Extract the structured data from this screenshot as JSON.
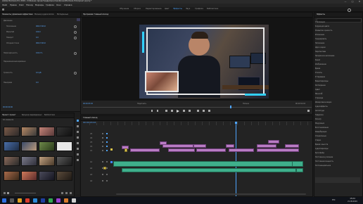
{
  "window": {
    "title": "Adobe Premiere Pro 2019 - D:\\Бизнес-проект\\видео\\монтаж\\Уроки\\Premiere Pro\\проект.prproj *",
    "controls": [
      "—",
      "□",
      "✕"
    ]
  },
  "menu": [
    "Файл",
    "Правка",
    "Клип",
    "Эпизод",
    "Маркеры",
    "Графика",
    "Окно",
    "Справка"
  ],
  "workspaces": [
    "Обучение",
    "Сборка",
    "Редактирование",
    "Цвет",
    "Эффекты",
    "Звук",
    "Графика",
    "Библиотеки"
  ],
  "active_workspace_index": 4,
  "effect_controls": {
    "tabs": [
      "Элементы управления эффектами",
      "Микшер аудиоклипов",
      "Метаданные"
    ],
    "props": [
      {
        "label": "Движение",
        "value": ""
      },
      {
        "label": "Положение",
        "value": "960,0 540,0"
      },
      {
        "label": "Масштаб",
        "value": "100,0"
      },
      {
        "label": "Поворот",
        "value": "0,0"
      },
      {
        "label": "Опорная точка",
        "value": "960,0 540,0"
      },
      {
        "label": "Непрозрачность",
        "value": "100,0 %"
      },
      {
        "label": "Переназначение времени",
        "value": ""
      },
      {
        "label": "Громкость",
        "value": "0,0 дБ"
      },
      {
        "label": "Панорама",
        "value": "0,0"
      }
    ],
    "timecode": "00:00:00:00"
  },
  "project": {
    "tabs": [
      "Проект: проект",
      "Браузер медиаданных",
      "Библиотеки"
    ],
    "item_count": "62 элемента"
  },
  "program_monitor": {
    "tab": "Программа: Главный эпизод",
    "timecode_current": "00:04:03:02",
    "fit": "Подогнать",
    "quality": "Полное",
    "timecode_total": "00:10:52:18"
  },
  "timeline": {
    "tab": "Главный эпизод",
    "timecode": "00:04:03:02",
    "video_tracks": [
      "V5",
      "V4",
      "V3",
      "V2",
      "V1"
    ],
    "audio_tracks": [
      "A1",
      "A2",
      "A3",
      "A4"
    ]
  },
  "effects": {
    "tab": "Эффекты",
    "items": [
      "Стилизация",
      "Коррекция цвета",
      "Размытие и резкость",
      "Искажение",
      "Генерировать",
      "Наложение",
      "Шум и зерно",
      "Перспектива",
      "Прозрачное наложение",
      "Канал",
      "Изображение",
      "Время",
      "Утилиты",
      "Устаревшие",
      "Видеопереходы",
      "Растворение",
      "Сдвиг",
      "Масштаб",
      "Страница",
      "Иммерсивное видео",
      "Аудиоэффекты",
      "Амплитуда",
      "Задержка",
      "Фильтр",
      "Модуляция",
      "Восстановление",
      "Реверберация",
      "Специальные",
      "Стерео",
      "Время и высота",
      "Аудиопереходы",
      "Кроссфейд",
      "Постоянное усиление",
      "Постоянная мощность",
      "Экспоненциальное"
    ]
  },
  "taskbar": {
    "time": "15:04",
    "date": "21.09.2019",
    "lang": "РУС"
  },
  "colors": {
    "accent": "#4ea5ff",
    "video_clip": "#b97cc4",
    "audio_clip": "#3fb08c",
    "playhead": "#4ea5ff"
  }
}
